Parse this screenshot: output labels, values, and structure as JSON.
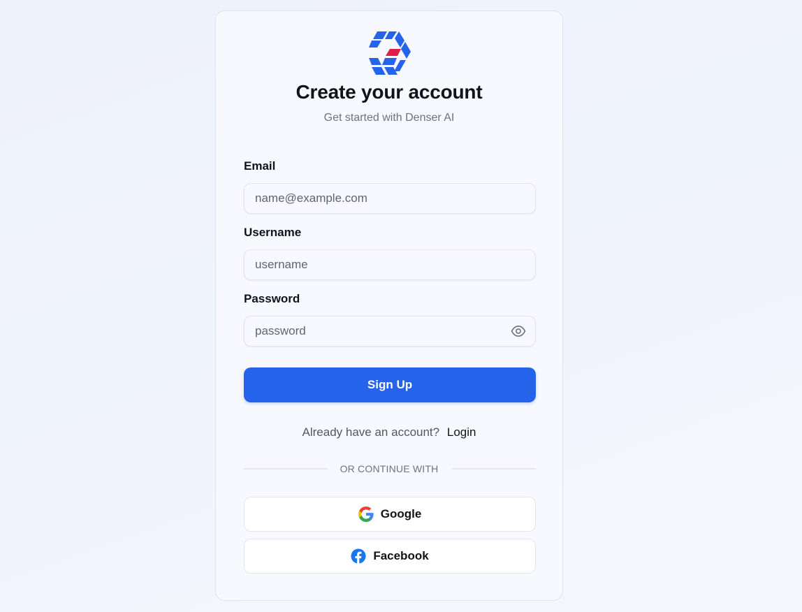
{
  "header": {
    "title": "Create your account",
    "subtitle": "Get started with Denser AI"
  },
  "form": {
    "email": {
      "label": "Email",
      "placeholder": "name@example.com",
      "value": ""
    },
    "username": {
      "label": "Username",
      "placeholder": "username",
      "value": ""
    },
    "password": {
      "label": "Password",
      "placeholder": "password",
      "value": ""
    },
    "submit_label": "Sign Up"
  },
  "login_prompt": {
    "text": "Already have an account?",
    "link_label": "Login"
  },
  "divider": {
    "text": "OR CONTINUE WITH"
  },
  "social": {
    "google_label": "Google",
    "facebook_label": "Facebook"
  },
  "icons": {
    "logo": "denser-logo-icon",
    "eye": "eye-icon",
    "google": "google-icon",
    "facebook": "facebook-icon"
  },
  "colors": {
    "primary": "#2563eb",
    "logo_blue": "#2563eb",
    "logo_red": "#e11d48",
    "facebook_blue": "#1877f2"
  }
}
